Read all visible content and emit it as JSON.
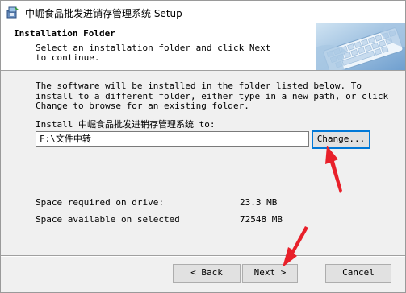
{
  "window": {
    "title": "中崛食品批发进销存管理系统 Setup",
    "icon": "installer-icon"
  },
  "header": {
    "title": "Installation Folder",
    "subtitle": "Select an installation folder and click Next to continue.",
    "banner_icon": "keyboard-image"
  },
  "content": {
    "description": "The software will be installed in the folder listed below. To install to a different folder, either type in a new path, or click Change to browse for an existing folder.",
    "install_label": "Install 中崛食品批发进销存管理系统 to:",
    "install_path": "F:\\文件中转",
    "change_label": "Change...",
    "space_required_label": "Space required on drive:",
    "space_required_value": "23.3 MB",
    "space_available_label": "Space available on selected",
    "space_available_value": "72548 MB"
  },
  "footer": {
    "back_label": "< Back",
    "next_label": "Next >",
    "cancel_label": "Cancel"
  },
  "colors": {
    "annotation_arrow": "#e8202a",
    "focus_border": "#0078d7",
    "dialog_background": "#f0f0f0"
  }
}
